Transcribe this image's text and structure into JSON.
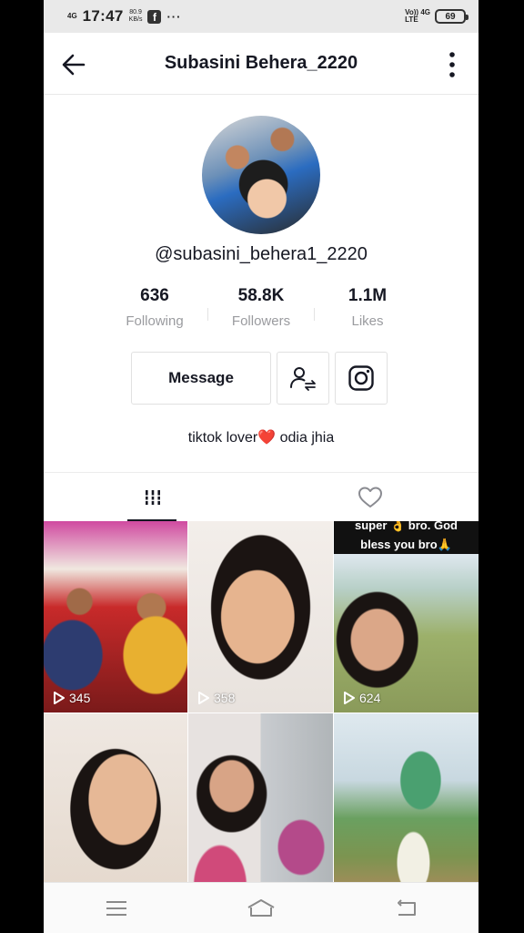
{
  "status_bar": {
    "network": "4G",
    "time": "17:47",
    "speed_value": "80.9",
    "speed_unit": "KB/s",
    "facebook_icon": "f",
    "more": "···",
    "volte": "Vo)) 4G",
    "lte": "LTE",
    "battery": "69"
  },
  "header": {
    "title": "Subasini Behera_2220",
    "back_icon": "arrow-left-icon",
    "more_icon": "vertical-dots-icon"
  },
  "profile": {
    "username": "@subasini_behera1_2220",
    "stats": [
      {
        "value": "636",
        "label": "Following"
      },
      {
        "value": "58.8K",
        "label": "Followers"
      },
      {
        "value": "1.1M",
        "label": "Likes"
      }
    ],
    "message_label": "Message",
    "bio_prefix": "tiktok lover",
    "bio_heart": "❤️",
    "bio_suffix": " odia jhia"
  },
  "tabs": [
    {
      "icon": "grid-icon",
      "active": true
    },
    {
      "icon": "heart-outline-icon",
      "active": false
    }
  ],
  "videos": [
    {
      "views": "345",
      "caption": ""
    },
    {
      "views": "358",
      "caption": ""
    },
    {
      "views": "624",
      "caption_line1": "super 👌 bro.  God",
      "caption_line2": "bless you bro🙏"
    },
    {
      "views": "",
      "caption": ""
    },
    {
      "views": "",
      "caption": ""
    },
    {
      "views": "",
      "caption": ""
    }
  ],
  "navbar": [
    "menu-icon",
    "home-icon",
    "back-icon"
  ]
}
